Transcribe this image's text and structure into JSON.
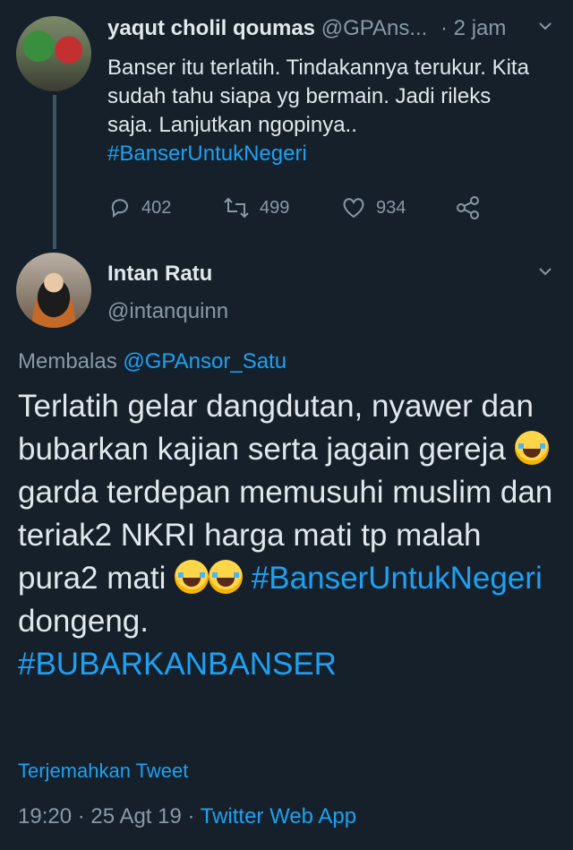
{
  "tweet1": {
    "display_name": "yaqut cholil qoumas",
    "handle": "@GPAns...",
    "separator": "·",
    "time": "2 jam",
    "text": "Banser itu terlatih. Tindakannya terukur. Kita sudah tahu siapa yg bermain. Jadi rileks saja. Lanjutkan ngopinya..",
    "hashtag": "#BanserUntukNegeri",
    "actions": {
      "reply_count": "402",
      "retweet_count": "499",
      "like_count": "934"
    },
    "icons": [
      "reply-icon",
      "retweet-icon",
      "like-icon",
      "share-icon",
      "chevron-down-icon"
    ]
  },
  "tweet2": {
    "display_name": "Intan Ratu",
    "handle": "@intanquinn",
    "reply_prefix": "Membalas",
    "reply_to": "@GPAnsor_Satu",
    "text_part1": "Terlatih gelar dangdutan, nyawer dan bubarkan kajian serta jagain gereja",
    "text_part2": "garda terdepan memusuhi muslim dan teriak2 NKRI harga mati tp malah pura2 mati",
    "hashtag1": "#BanserUntukNegeri",
    "text_part3": "dongeng.",
    "hashtag2": "#BUBARKANBANSER",
    "translate": "Terjemahkan Tweet",
    "time": "19:20",
    "date": "25 Agt 19",
    "source": "Twitter Web App",
    "separator": "·"
  },
  "colors": {
    "background": "#15202b",
    "text": "#e1e8ed",
    "muted": "#8899a6",
    "link": "#1da1f2",
    "thread_line": "#3d5466"
  }
}
